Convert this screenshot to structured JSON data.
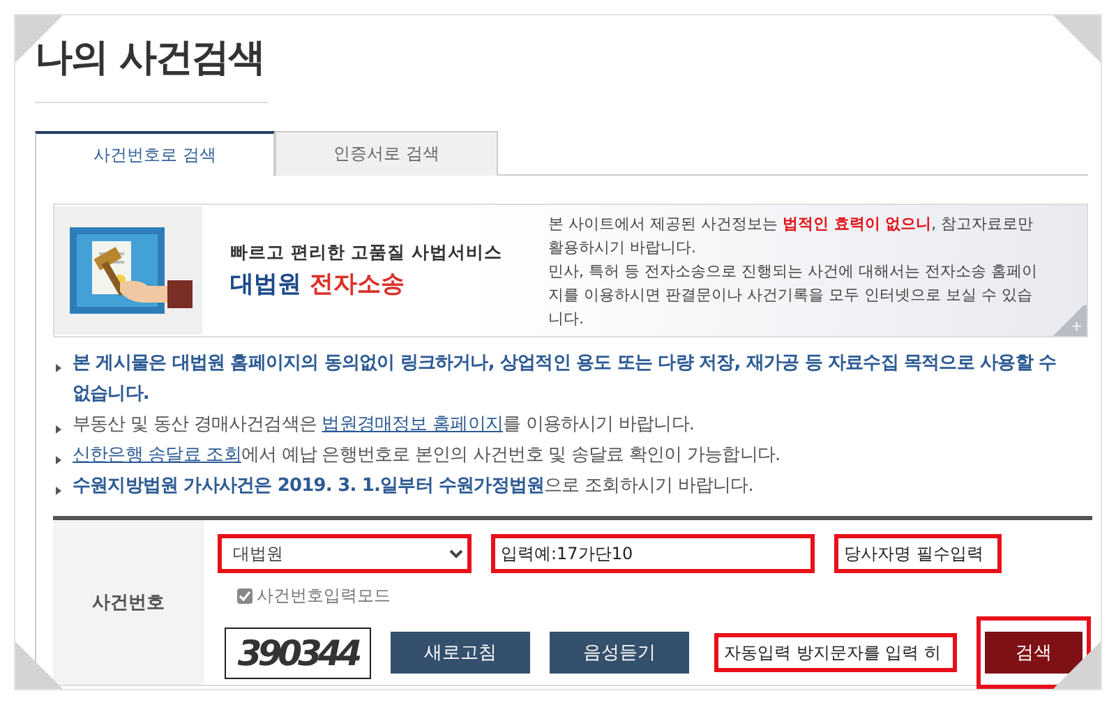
{
  "title": "나의 사건검색",
  "tabs": [
    {
      "label": "사건번호로 검색",
      "selected": true
    },
    {
      "label": "인증서로 검색",
      "selected": false
    }
  ],
  "banner": {
    "tagline": "빠르고 편리한 고품질 사법서비스",
    "brand_primary": "대법원",
    "brand_accent": "전자소송",
    "notice": [
      "본 사이트에서 제공된 사건정보는 **법적인 효력이 없으니**, 참고자료로만 활용하시기 바랍니다.",
      "민사, 특허 등 전자소송으로 진행되는 사건에 대해서는 전자소송 홈페이지를 이용하시면 판결문이나 사건기록을 모두 인터넷으로 보실 수 있습니다."
    ],
    "more": "+"
  },
  "notices": [
    {
      "segments": [
        {
          "kind": "bold",
          "text": "본 게시물은 대법원 홈페이지의 동의없이 링크하거나, 상업적인 용도 또는 다량 저장, 재가공 등 자료수집 목적으로 사용할 수 없습니다."
        }
      ]
    },
    {
      "segments": [
        {
          "kind": "plain",
          "text": "부동산 및 동산 경매사건검색은 "
        },
        {
          "kind": "link",
          "text": "법원경매정보 홈페이지"
        },
        {
          "kind": "plain",
          "text": "를 이용하시기 바랍니다."
        }
      ]
    },
    {
      "segments": [
        {
          "kind": "link",
          "text": "신한은행 송달료 조회"
        },
        {
          "kind": "plain",
          "text": "에서 예납 은행번호로 본인의 사건번호 및 송달료 확인이 가능합니다."
        }
      ]
    },
    {
      "segments": [
        {
          "kind": "bold",
          "text": "수원지방법원 가사사건은 2019. 3. 1.일부터 수원가정법원"
        },
        {
          "kind": "plain",
          "text": "으로 조회하시기 바랍니다."
        }
      ]
    }
  ],
  "form": {
    "label": "사건번호",
    "court_select": {
      "value": "대법원",
      "highlighted": true
    },
    "case_number": {
      "placeholder": "입력예:17가단10",
      "highlighted": true
    },
    "party_name": {
      "placeholder": "당사자명 필수입력",
      "highlighted": true
    },
    "input_mode": {
      "label": "사건번호입력모드",
      "checked": true
    },
    "captcha": {
      "text": "390344"
    },
    "refresh_button": "새로고침",
    "audio_button": "음성듣기",
    "captcha_field": {
      "placeholder": "자동입력 방지문자를 입력 히",
      "highlighted": true
    },
    "search_button": {
      "label": "검색",
      "highlighted": true
    }
  }
}
